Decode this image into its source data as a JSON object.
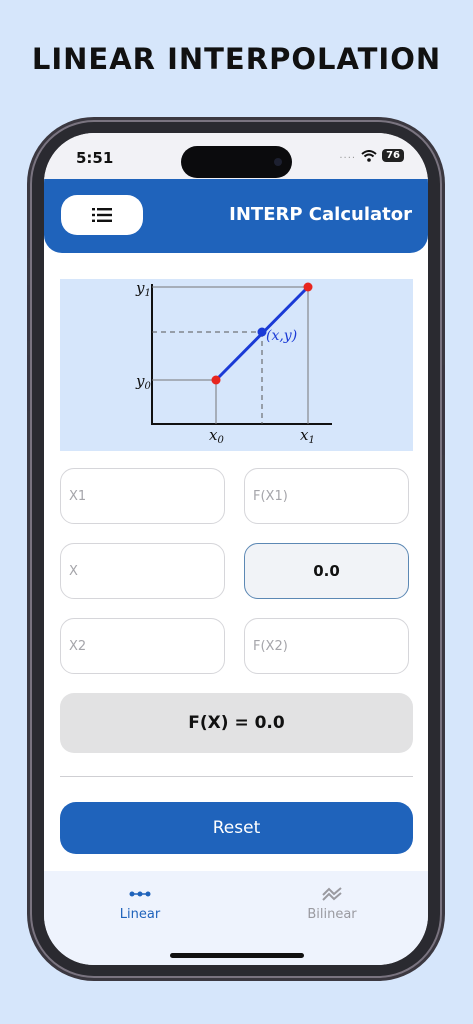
{
  "headline": "LINEAR INTERPOLATION",
  "status": {
    "time": "5:51",
    "signal": "....",
    "battery": "76"
  },
  "appbar": {
    "title": "INTERP Calculator",
    "menu_icon": "menu-lines-icon"
  },
  "diagram": {
    "y1": "y",
    "y1_sub": "1",
    "y0": "y",
    "y0_sub": "0",
    "x0": "x",
    "x0_sub": "0",
    "x1": "x",
    "x1_sub": "1",
    "point": "(x,y)"
  },
  "fields": {
    "x1_placeholder": "X1",
    "fx1_placeholder": "F(X1)",
    "x_placeholder": "X",
    "x_value": "0.0",
    "x2_placeholder": "X2",
    "fx2_placeholder": "F(X2)"
  },
  "result": "F(X) = 0.0",
  "reset_label": "Reset",
  "tabs": [
    {
      "label": "Linear",
      "icon": "linear-dots-icon",
      "active": true
    },
    {
      "label": "Bilinear",
      "icon": "bilinear-chevrons-icon",
      "active": false
    }
  ],
  "colors": {
    "primary": "#1f63bb",
    "background": "#d6e6fb",
    "point_red": "#e8261e",
    "point_blue": "#1a3ad6"
  }
}
